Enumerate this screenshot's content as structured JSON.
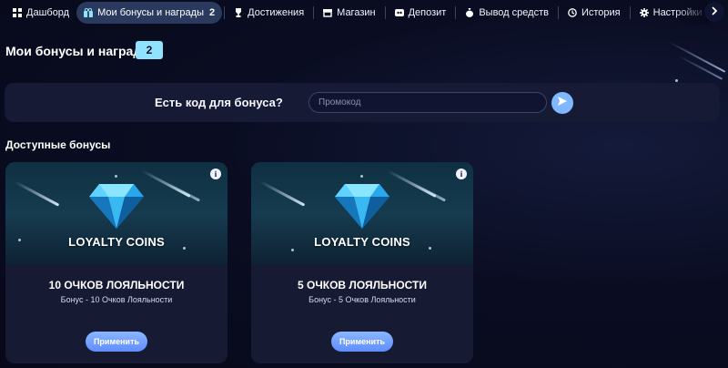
{
  "nav": {
    "items": [
      {
        "label": "Дашборд",
        "icon": "dashboard-grid-icon"
      },
      {
        "label": "Мои бонусы и награды",
        "icon": "gift-icon",
        "count": "2",
        "active": true
      },
      {
        "label": "Достижения",
        "icon": "trophy-icon"
      },
      {
        "label": "Магазин",
        "icon": "shop-icon"
      },
      {
        "label": "Депозит",
        "icon": "wallet-icon"
      },
      {
        "label": "Вывод средств",
        "icon": "money-bag-icon"
      },
      {
        "label": "История",
        "icon": "clock-icon"
      },
      {
        "label": "Настройки о",
        "icon": "gear-icon"
      }
    ],
    "more_icon": "chevron-right-icon"
  },
  "page": {
    "title": "Мои бонусы и награды",
    "badge": "2"
  },
  "promo": {
    "label": "Есть код для бонуса?",
    "placeholder": "Промокод",
    "value": "",
    "send_icon": "send-icon"
  },
  "section": {
    "title": "Доступные бонусы"
  },
  "cards": [
    {
      "brand": "LOYALTY COINS",
      "title": "10 ОЧКОВ ЛОЯЛЬНОСТИ",
      "subtitle": "Бонус - 10 Очков Лояльности",
      "button": "Применить",
      "info": "i"
    },
    {
      "brand": "LOYALTY COINS",
      "title": "5 ОЧКОВ ЛОЯЛЬНОСТИ",
      "subtitle": "Бонус - 5 Очков Лояльности",
      "button": "Применить",
      "info": "i"
    }
  ],
  "colors": {
    "background": "#0a0d22",
    "panel": "#161a34",
    "accent": "#8fe3ff",
    "button": "#6f9cff",
    "active_tab": "#2a3a5e"
  }
}
